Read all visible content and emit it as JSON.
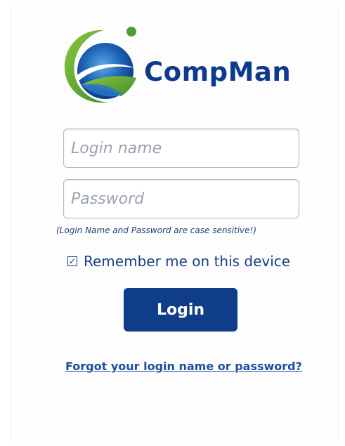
{
  "brand": {
    "name": "CompMan",
    "color": "#0d3a8c",
    "logo_icon": "globe-swoosh-icon"
  },
  "form": {
    "login_placeholder": "Login name",
    "password_placeholder": "Password",
    "hint": "(Login Name and Password are case sensitive!)",
    "remember_label": "Remember me on this device",
    "remember_checked": true,
    "login_button": "Login",
    "forgot_link": "Forgot your login name or password?"
  },
  "colors": {
    "primary": "#0f3d89",
    "logo_green": "#5aa63a",
    "logo_blue": "#1c5fb3"
  }
}
